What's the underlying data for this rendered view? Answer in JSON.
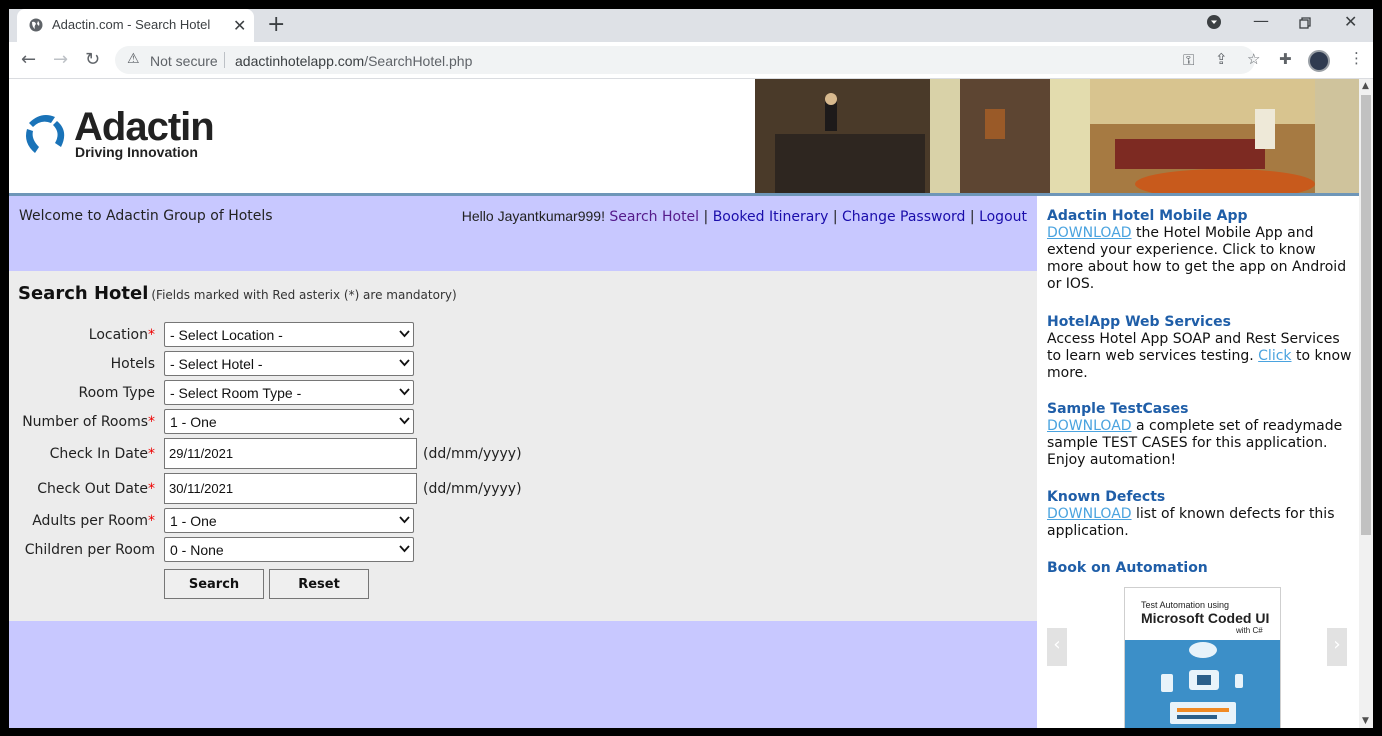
{
  "browser": {
    "tab_title": "Adactin.com - Search Hotel",
    "security_label": "Not secure",
    "url_host": "adactinhotelapp.com",
    "url_path": "/SearchHotel.php"
  },
  "header": {
    "logo_name": "Adactin",
    "logo_tagline": "Driving Innovation"
  },
  "welcome": {
    "text": "Welcome to Adactin Group of Hotels",
    "hello": "Hello Jayantkumar999!",
    "nav": {
      "search_hotel": "Search Hotel",
      "booked_itinerary": "Booked Itinerary",
      "change_password": "Change Password",
      "logout": "Logout",
      "separator": "|"
    }
  },
  "form": {
    "title": "Search Hotel",
    "note": "(Fields marked with Red asterix (*) are mandatory)",
    "required_mark": "*",
    "date_format": "(dd/mm/yyyy)",
    "fields": {
      "location": {
        "label": "Location",
        "value": "- Select Location -"
      },
      "hotels": {
        "label": "Hotels",
        "value": "- Select Hotel -"
      },
      "room_type": {
        "label": "Room Type",
        "value": "- Select Room Type -"
      },
      "number_of_rooms": {
        "label": "Number of Rooms",
        "value": "1 - One"
      },
      "check_in": {
        "label": "Check In Date",
        "value": "29/11/2021"
      },
      "check_out": {
        "label": "Check Out Date",
        "value": "30/11/2021"
      },
      "adults": {
        "label": "Adults per Room",
        "value": "1 - One"
      },
      "children": {
        "label": "Children per Room",
        "value": "0 - None"
      }
    },
    "search_button": "Search",
    "reset_button": "Reset"
  },
  "sidebar": {
    "mobile_app": {
      "heading": "Adactin Hotel Mobile App",
      "link": "DOWNLOAD",
      "text": " the Hotel Mobile App and extend your experience. Click to know more about how to get the app on Android or IOS."
    },
    "web_services": {
      "heading": "HotelApp Web Services",
      "text_before": "Access Hotel App SOAP and Rest Services to learn web services testing. ",
      "link": "Click",
      "text_after": " to know more."
    },
    "test_cases": {
      "heading": "Sample TestCases",
      "link": "DOWNLOAD",
      "text": " a complete set of readymade sample TEST CASES for this application. Enjoy automation!"
    },
    "defects": {
      "heading": "Known Defects",
      "link": "DOWNLOAD",
      "text": " list of known defects for this application."
    },
    "book": {
      "heading": "Book on Automation",
      "cover_top": "Test Automation using",
      "cover_title": "Microsoft Coded UI",
      "cover_sub": "with C#"
    }
  },
  "colors": {
    "band": "#c8c8ff",
    "form_bg": "#ececec",
    "heading_blue": "#1f5ea8",
    "link": "#4aa3df",
    "required": "#e00000"
  }
}
